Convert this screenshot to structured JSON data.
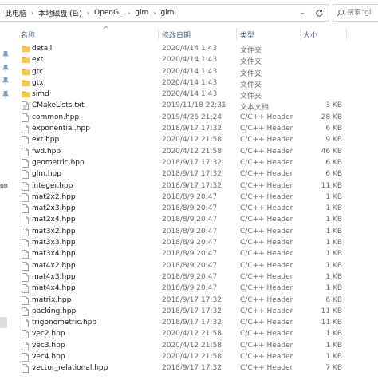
{
  "address": {
    "crumbs": [
      "此电脑",
      "本地磁盘 (E:)",
      "OpenGL",
      "glm",
      "glm"
    ],
    "dropdown_glyph": "⌄"
  },
  "search": {
    "placeholder": "搜索\"gl"
  },
  "nav": {
    "partial_label": "on"
  },
  "columns": {
    "name": "名称",
    "date": "修改日期",
    "type": "类型",
    "size": "大小"
  },
  "files": [
    {
      "name": "detail",
      "date": "2020/4/14 1:43",
      "type": "文件夹",
      "size": "",
      "icon": "folder-icon"
    },
    {
      "name": "ext",
      "date": "2020/4/14 1:43",
      "type": "文件夹",
      "size": "",
      "icon": "folder-icon"
    },
    {
      "name": "gtc",
      "date": "2020/4/14 1:43",
      "type": "文件夹",
      "size": "",
      "icon": "folder-icon"
    },
    {
      "name": "gtx",
      "date": "2020/4/14 1:43",
      "type": "文件夹",
      "size": "",
      "icon": "folder-icon"
    },
    {
      "name": "simd",
      "date": "2020/4/14 1:43",
      "type": "文件夹",
      "size": "",
      "icon": "folder-icon"
    },
    {
      "name": "CMakeLists.txt",
      "date": "2019/11/18 22:31",
      "type": "文本文档",
      "size": "3 KB",
      "icon": "text-file-icon"
    },
    {
      "name": "common.hpp",
      "date": "2019/4/26 21:24",
      "type": "C/C++ Header",
      "size": "28 KB",
      "icon": "file-icon"
    },
    {
      "name": "exponential.hpp",
      "date": "2018/9/17 17:32",
      "type": "C/C++ Header",
      "size": "6 KB",
      "icon": "file-icon"
    },
    {
      "name": "ext.hpp",
      "date": "2020/4/12 21:58",
      "type": "C/C++ Header",
      "size": "9 KB",
      "icon": "file-icon"
    },
    {
      "name": "fwd.hpp",
      "date": "2020/4/12 21:58",
      "type": "C/C++ Header",
      "size": "46 KB",
      "icon": "file-icon"
    },
    {
      "name": "geometric.hpp",
      "date": "2018/9/17 17:32",
      "type": "C/C++ Header",
      "size": "6 KB",
      "icon": "file-icon"
    },
    {
      "name": "glm.hpp",
      "date": "2018/9/17 17:32",
      "type": "C/C++ Header",
      "size": "6 KB",
      "icon": "file-icon"
    },
    {
      "name": "integer.hpp",
      "date": "2018/9/17 17:32",
      "type": "C/C++ Header",
      "size": "11 KB",
      "icon": "file-icon"
    },
    {
      "name": "mat2x2.hpp",
      "date": "2018/8/9 20:47",
      "type": "C/C++ Header",
      "size": "1 KB",
      "icon": "file-icon"
    },
    {
      "name": "mat2x3.hpp",
      "date": "2018/8/9 20:47",
      "type": "C/C++ Header",
      "size": "1 KB",
      "icon": "file-icon"
    },
    {
      "name": "mat2x4.hpp",
      "date": "2018/8/9 20:47",
      "type": "C/C++ Header",
      "size": "1 KB",
      "icon": "file-icon"
    },
    {
      "name": "mat3x2.hpp",
      "date": "2018/8/9 20:47",
      "type": "C/C++ Header",
      "size": "1 KB",
      "icon": "file-icon"
    },
    {
      "name": "mat3x3.hpp",
      "date": "2018/8/9 20:47",
      "type": "C/C++ Header",
      "size": "1 KB",
      "icon": "file-icon"
    },
    {
      "name": "mat3x4.hpp",
      "date": "2018/8/9 20:47",
      "type": "C/C++ Header",
      "size": "1 KB",
      "icon": "file-icon"
    },
    {
      "name": "mat4x2.hpp",
      "date": "2018/8/9 20:47",
      "type": "C/C++ Header",
      "size": "1 KB",
      "icon": "file-icon"
    },
    {
      "name": "mat4x3.hpp",
      "date": "2018/8/9 20:47",
      "type": "C/C++ Header",
      "size": "1 KB",
      "icon": "file-icon"
    },
    {
      "name": "mat4x4.hpp",
      "date": "2018/8/9 20:47",
      "type": "C/C++ Header",
      "size": "1 KB",
      "icon": "file-icon"
    },
    {
      "name": "matrix.hpp",
      "date": "2018/9/17 17:32",
      "type": "C/C++ Header",
      "size": "6 KB",
      "icon": "file-icon"
    },
    {
      "name": "packing.hpp",
      "date": "2018/9/17 17:32",
      "type": "C/C++ Header",
      "size": "11 KB",
      "icon": "file-icon"
    },
    {
      "name": "trigonometric.hpp",
      "date": "2018/9/17 17:32",
      "type": "C/C++ Header",
      "size": "11 KB",
      "icon": "file-icon"
    },
    {
      "name": "vec2.hpp",
      "date": "2020/4/12 21:58",
      "type": "C/C++ Header",
      "size": "1 KB",
      "icon": "file-icon"
    },
    {
      "name": "vec3.hpp",
      "date": "2020/4/12 21:58",
      "type": "C/C++ Header",
      "size": "1 KB",
      "icon": "file-icon"
    },
    {
      "name": "vec4.hpp",
      "date": "2020/4/12 21:58",
      "type": "C/C++ Header",
      "size": "1 KB",
      "icon": "file-icon"
    },
    {
      "name": "vector_relational.hpp",
      "date": "2018/9/17 17:32",
      "type": "C/C++ Header",
      "size": "7 KB",
      "icon": "file-icon"
    }
  ],
  "colors": {
    "folder": "#f7c948",
    "folder_dark": "#e5a823",
    "header_text": "#4c607a",
    "border": "#d9d9d9",
    "secondary_text": "#6d6d6d",
    "pin": "#8aa0b8"
  }
}
